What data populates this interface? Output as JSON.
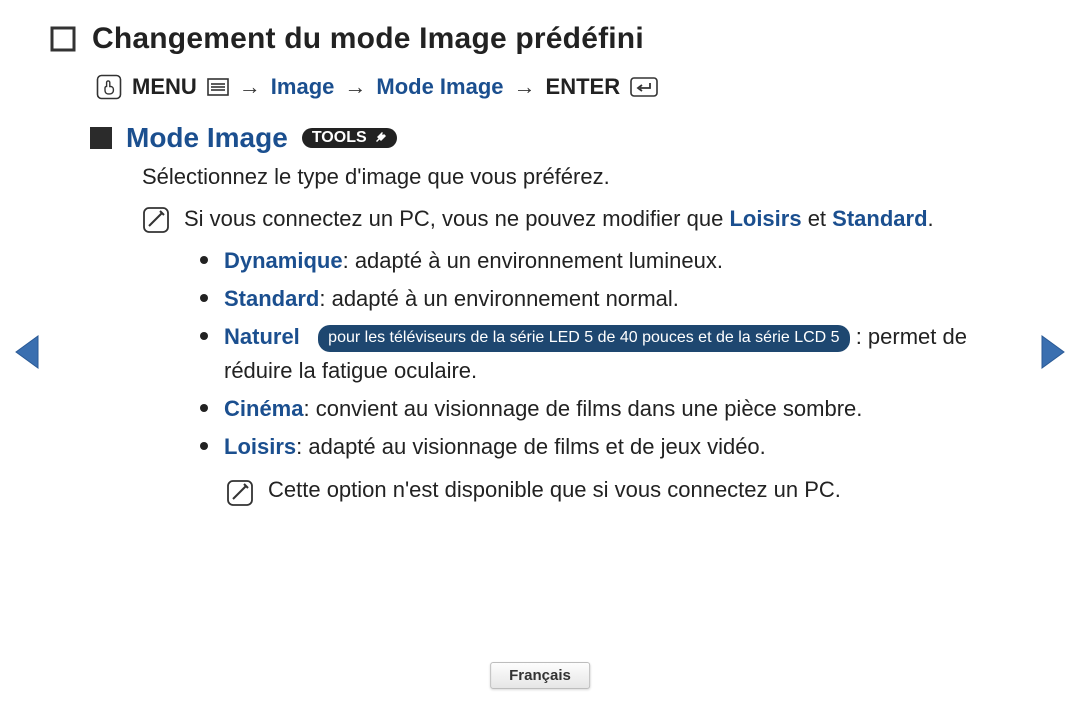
{
  "title": "Changement du mode Image prédéfini",
  "breadcrumb": {
    "menu": "MENU",
    "seg1": "Image",
    "seg2": "Mode Image",
    "enter": "ENTER",
    "arrow": "→"
  },
  "section": {
    "heading": "Mode Image",
    "tools_label": "TOOLS"
  },
  "intro": "Sélectionnez le type d'image que vous préférez.",
  "note1": {
    "prefix": "Si vous connectez un PC, vous ne pouvez modifier que ",
    "loisirs": "Loisirs",
    "et": " et ",
    "standard": "Standard",
    "suffix": "."
  },
  "bullets": {
    "b1": {
      "label": "Dynamique",
      "text": ": adapté à un environnement lumineux."
    },
    "b2": {
      "label": "Standard",
      "text": ": adapté à un environnement normal."
    },
    "b3": {
      "label": "Naturel",
      "pill": "pour les téléviseurs de la série  LED 5  de 40 pouces et de la série LCD 5",
      "text_after_pill": ": permet de réduire la fatigue oculaire."
    },
    "b4": {
      "label": "Cinéma",
      "text": ": convient au visionnage de films dans une pièce sombre."
    },
    "b5": {
      "label": "Loisirs",
      "text": ": adapté au visionnage de films et de jeux vidéo."
    }
  },
  "note2": "Cette option n'est disponible que si vous connectez un PC.",
  "language_label": "Français"
}
